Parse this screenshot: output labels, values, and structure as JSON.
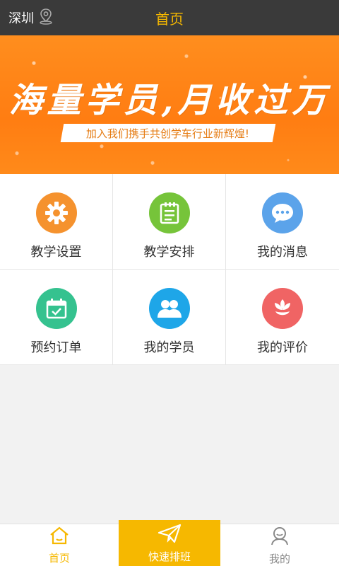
{
  "header": {
    "city": "深圳",
    "title": "首页"
  },
  "banner": {
    "headline": "海量学员,月收过万",
    "subline": "加入我们携手共创学车行业新辉煌!",
    "slide_count": 2,
    "active_slide": 1
  },
  "grid": [
    {
      "label": "教学设置",
      "icon": "gear-icon",
      "color": "#f5922e"
    },
    {
      "label": "教学安排",
      "icon": "notepad-icon",
      "color": "#76c43a"
    },
    {
      "label": "我的消息",
      "icon": "chat-bubble-icon",
      "color": "#5ba3ea"
    },
    {
      "label": "预约订单",
      "icon": "calendar-check-icon",
      "color": "#35c28f"
    },
    {
      "label": "我的学员",
      "icon": "users-icon",
      "color": "#1ea6e8"
    },
    {
      "label": "我的评价",
      "icon": "flower-icon",
      "color": "#f06464"
    }
  ],
  "tabs": {
    "home": "首页",
    "quick": "快速排班",
    "mine": "我的"
  },
  "colors": {
    "accent": "#f6b800",
    "topbar": "#3a3a3a",
    "banner": "#ff8513"
  }
}
